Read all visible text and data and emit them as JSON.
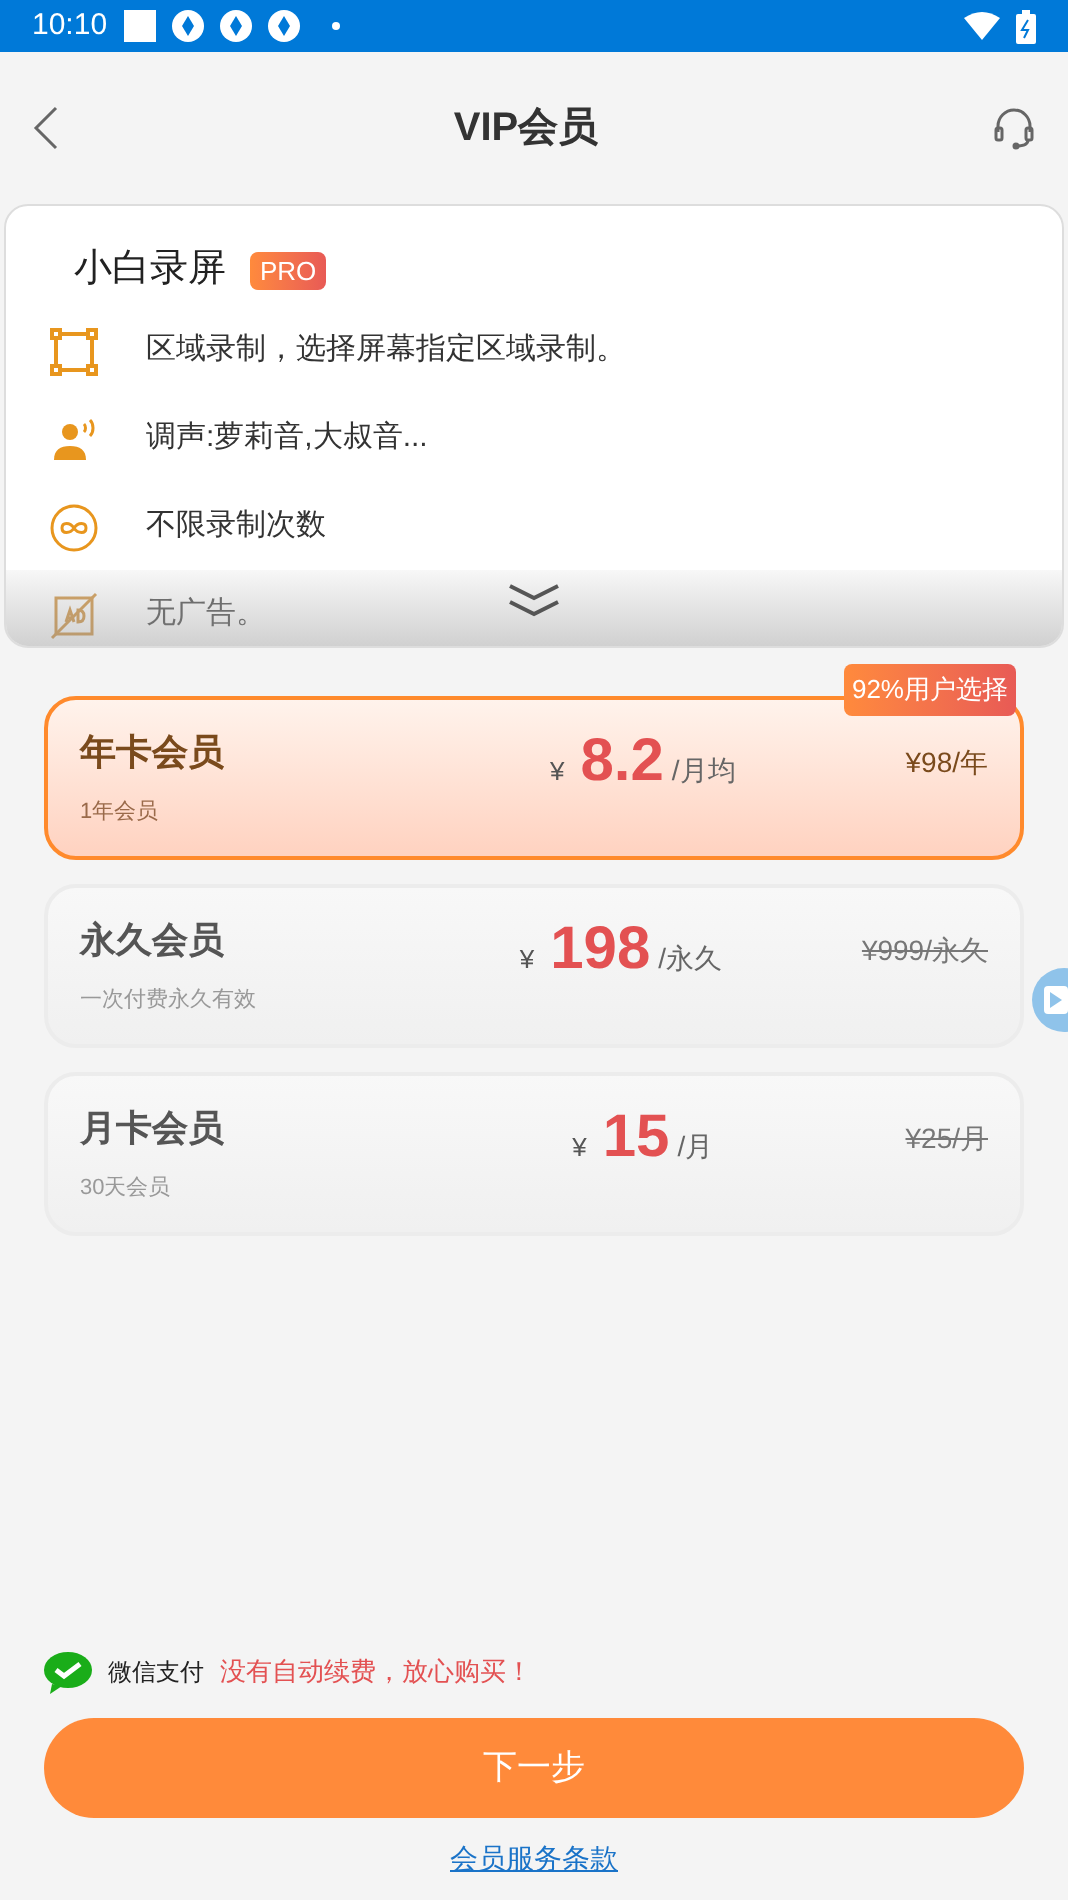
{
  "status_bar": {
    "time": "10:10"
  },
  "header": {
    "title": "VIP会员"
  },
  "product": {
    "name": "小白录屏",
    "badge": "PRO",
    "features": [
      {
        "kind": "region",
        "text": "区域录制，选择屏幕指定区域录制。"
      },
      {
        "kind": "voice",
        "text": "调声:萝莉音,大叔音..."
      },
      {
        "kind": "infinite",
        "text": "不限录制次数"
      },
      {
        "kind": "noad",
        "text": "无广告。"
      }
    ]
  },
  "plans": [
    {
      "name": "年卡会员",
      "subtitle": "1年会员",
      "currency": "¥",
      "price": "8.2",
      "unit": "/月均",
      "original": "¥98/年",
      "struck": false,
      "selected": true,
      "badge": "92%用户选择"
    },
    {
      "name": "永久会员",
      "subtitle": "一次付费永久有效",
      "currency": "¥",
      "price": "198",
      "unit": "/永久",
      "original": "¥999/永久",
      "struck": true,
      "selected": false
    },
    {
      "name": "月卡会员",
      "subtitle": "30天会员",
      "currency": "¥",
      "price": "15",
      "unit": "/月",
      "original": "¥25/月",
      "struck": true,
      "selected": false
    }
  ],
  "payment": {
    "method": "微信支付",
    "note": "没有自动续费，放心购买！"
  },
  "next_button": "下一步",
  "terms_link": "会员服务条款"
}
